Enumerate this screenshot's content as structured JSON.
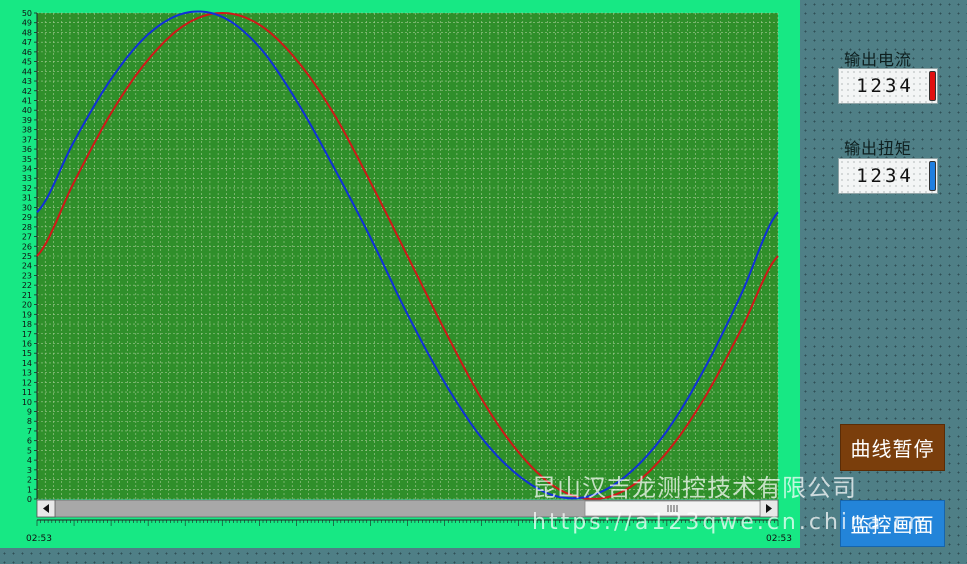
{
  "trend": {
    "y_ticks": [
      "0",
      "1",
      "2",
      "3",
      "4",
      "5",
      "6",
      "7",
      "8",
      "9",
      "10",
      "11",
      "12",
      "13",
      "14",
      "15",
      "16",
      "17",
      "18",
      "19",
      "20",
      "21",
      "22",
      "23",
      "24",
      "25",
      "26",
      "27",
      "28",
      "29",
      "30",
      "31",
      "32",
      "33",
      "34",
      "35",
      "36",
      "37",
      "38",
      "39",
      "40",
      "41",
      "42",
      "43",
      "44",
      "45",
      "46",
      "47",
      "48",
      "49",
      "50"
    ],
    "time_start": "02:53",
    "time_end": "02:53",
    "colors": {
      "plot_bg": "#2f8f2a",
      "panel_bg": "#17e884",
      "red_series": "#d01818",
      "blue_series": "#1030d8"
    }
  },
  "chart_data": {
    "type": "line",
    "ylim": [
      0,
      50
    ],
    "x_ticks": [
      "02:53",
      "02:53"
    ],
    "x": [
      0,
      1,
      2,
      3,
      4,
      5,
      6,
      7,
      8,
      9,
      10,
      11,
      12,
      13,
      14,
      15,
      16,
      17,
      18,
      19,
      20
    ],
    "series": [
      {
        "color": "#d01818",
        "values": [
          25.0,
          32.6,
          39.7,
          45.2,
          48.8,
          50.0,
          48.8,
          45.2,
          39.7,
          32.6,
          25.0,
          17.4,
          10.3,
          4.8,
          1.2,
          0.0,
          1.2,
          4.8,
          10.3,
          17.4,
          25.0
        ]
      },
      {
        "color": "#1030d8",
        "values": [
          29.5,
          36.8,
          43.2,
          47.8,
          50.0,
          49.6,
          46.5,
          41.0,
          34.2,
          26.9,
          19.0,
          12.0,
          6.3,
          2.4,
          0.3,
          0.4,
          2.7,
          7.0,
          13.3,
          21.0,
          29.5
        ]
      }
    ]
  },
  "side": {
    "current_label": "输出电流",
    "current_value": "1234",
    "current_color": "#e01010",
    "torque_label": "输出扭矩",
    "torque_value": "1234",
    "torque_color": "#1f7fe0"
  },
  "buttons": {
    "pause": "曲线暂停",
    "monitor": "监控画面"
  },
  "watermark": {
    "line1": "昆山汉吉龙测控技术有限公司",
    "line2": "https://a123qwe.cn.china.cn"
  }
}
